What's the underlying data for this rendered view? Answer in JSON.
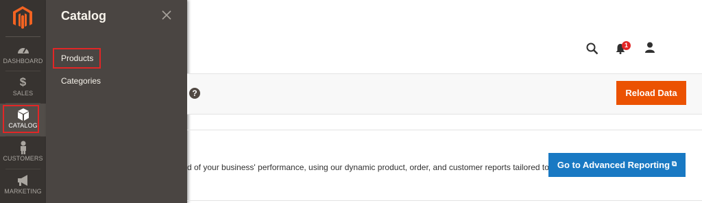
{
  "nav": {
    "items": [
      {
        "label": "DASHBOARD",
        "icon": "speedometer-icon"
      },
      {
        "label": "SALES",
        "icon": "dollar-icon"
      },
      {
        "label": "CATALOG",
        "icon": "box-icon"
      },
      {
        "label": "CUSTOMERS",
        "icon": "person-icon"
      },
      {
        "label": "MARKETING",
        "icon": "megaphone-icon"
      }
    ],
    "active": "CATALOG"
  },
  "flyout": {
    "title": "Catalog",
    "links": [
      "Products",
      "Categories"
    ],
    "highlighted": "Products"
  },
  "header": {
    "notification_count": "1"
  },
  "toolbar": {
    "help_symbol": "?",
    "reload_label": "Reload Data"
  },
  "advanced": {
    "description": "d of your business' performance, using our dynamic product, order, and customer reports tailored to",
    "button_label": "Go to Advanced Reporting"
  },
  "colors": {
    "nav_bg": "#373330",
    "flyout_bg": "#4a4542",
    "accent_orange": "#eb5202",
    "accent_blue": "#1979c3",
    "highlight_red": "#e22626"
  }
}
